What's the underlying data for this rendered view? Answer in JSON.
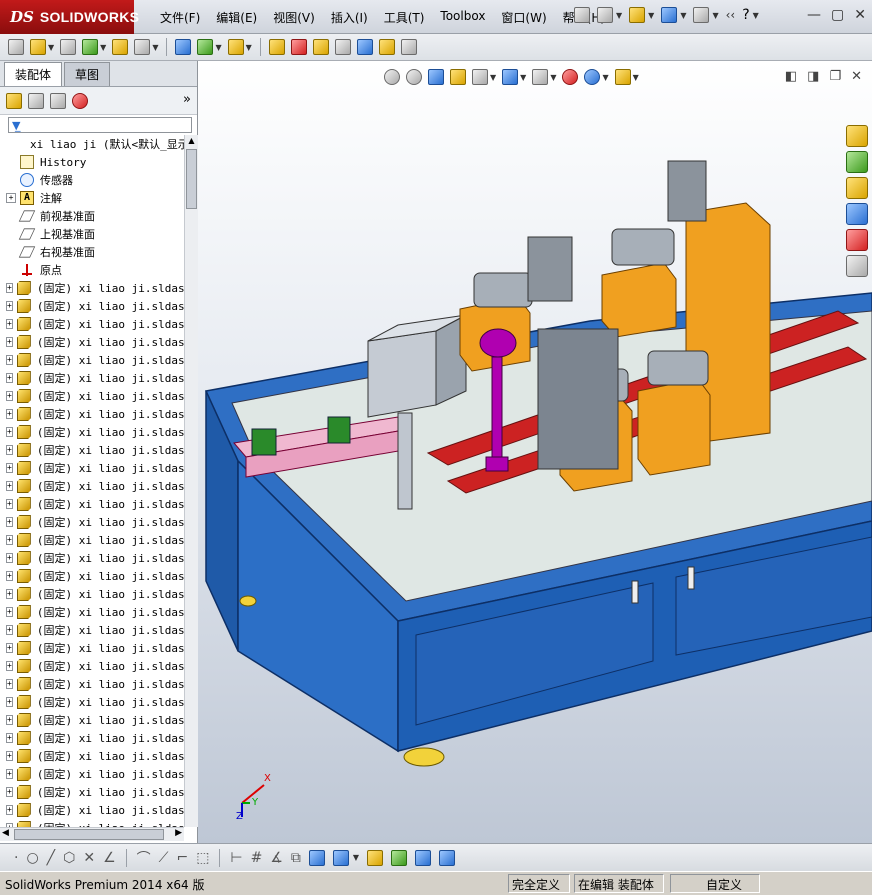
{
  "app": {
    "logo_ds": "DS",
    "logo_text": "SOLIDWORKS"
  },
  "menu": {
    "items": [
      "文件(F)",
      "编辑(E)",
      "视图(V)",
      "插入(I)",
      "工具(T)",
      "Toolbox",
      "窗口(W)",
      "帮助(H)"
    ]
  },
  "feature_manager": {
    "tabs": [
      "装配体",
      "草图"
    ],
    "chevron": "»",
    "filter_icon": "funnel-icon",
    "tree": [
      {
        "label": "xi liao ji  (默认<默认_显示",
        "icon": "assembly",
        "expand": "none"
      },
      {
        "label": "History",
        "icon": "hist",
        "expand": "none"
      },
      {
        "label": "传感器",
        "icon": "sensor",
        "expand": "none"
      },
      {
        "label": "注解",
        "icon": "annot",
        "expand": "plus"
      },
      {
        "label": "前视基准面",
        "icon": "plane",
        "expand": "none"
      },
      {
        "label": "上视基准面",
        "icon": "plane",
        "expand": "none"
      },
      {
        "label": "右视基准面",
        "icon": "plane",
        "expand": "none"
      },
      {
        "label": "原点",
        "icon": "origin",
        "expand": "none"
      },
      {
        "label": "(固定) xi liao ji.sldas",
        "icon": "part",
        "expand": "plus"
      },
      {
        "label": "(固定) xi liao ji.sldas",
        "icon": "part",
        "expand": "plus"
      },
      {
        "label": "(固定) xi liao ji.sldas",
        "icon": "part",
        "expand": "plus"
      },
      {
        "label": "(固定) xi liao ji.sldas",
        "icon": "part",
        "expand": "plus"
      },
      {
        "label": "(固定) xi liao ji.sldas",
        "icon": "part",
        "expand": "plus"
      },
      {
        "label": "(固定) xi liao ji.sldas",
        "icon": "part",
        "expand": "plus"
      },
      {
        "label": "(固定) xi liao ji.sldas",
        "icon": "part",
        "expand": "plus"
      },
      {
        "label": "(固定) xi liao ji.sldas",
        "icon": "part",
        "expand": "plus"
      },
      {
        "label": "(固定) xi liao ji.sldas",
        "icon": "part",
        "expand": "plus"
      },
      {
        "label": "(固定) xi liao ji.sldas",
        "icon": "part",
        "expand": "plus"
      },
      {
        "label": "(固定) xi liao ji.sldas",
        "icon": "part",
        "expand": "plus"
      },
      {
        "label": "(固定) xi liao ji.sldas",
        "icon": "part",
        "expand": "plus"
      },
      {
        "label": "(固定) xi liao ji.sldas",
        "icon": "part",
        "expand": "plus"
      },
      {
        "label": "(固定) xi liao ji.sldas",
        "icon": "part",
        "expand": "plus"
      },
      {
        "label": "(固定) xi liao ji.sldas",
        "icon": "part",
        "expand": "plus"
      },
      {
        "label": "(固定) xi liao ji.sldas",
        "icon": "part",
        "expand": "plus"
      },
      {
        "label": "(固定) xi liao ji.sldas",
        "icon": "part",
        "expand": "plus"
      },
      {
        "label": "(固定) xi liao ji.sldas",
        "icon": "part",
        "expand": "plus"
      },
      {
        "label": "(固定) xi liao ji.sldas",
        "icon": "part",
        "expand": "plus"
      },
      {
        "label": "(固定) xi liao ji.sldas",
        "icon": "part",
        "expand": "plus"
      },
      {
        "label": "(固定) xi liao ji.sldas",
        "icon": "part",
        "expand": "plus"
      },
      {
        "label": "(固定) xi liao ji.sldas",
        "icon": "part",
        "expand": "plus"
      },
      {
        "label": "(固定) xi liao ji.sldas",
        "icon": "part",
        "expand": "plus"
      },
      {
        "label": "(固定) xi liao ji.sldas",
        "icon": "part",
        "expand": "plus"
      },
      {
        "label": "(固定) xi liao ji.sldas",
        "icon": "part",
        "expand": "plus"
      },
      {
        "label": "(固定) xi liao ji.sldas",
        "icon": "part",
        "expand": "plus"
      },
      {
        "label": "(固定) xi liao ji.sldas",
        "icon": "part",
        "expand": "plus"
      },
      {
        "label": "(固定) xi liao ji.sldas",
        "icon": "part",
        "expand": "plus"
      },
      {
        "label": "(固定) xi liao ji.sldas",
        "icon": "part",
        "expand": "plus"
      },
      {
        "label": "(固定) xi liao ji.sldas",
        "icon": "part",
        "expand": "plus"
      },
      {
        "label": "(固定) xi liao ji.sldas",
        "icon": "part",
        "expand": "plus"
      },
      {
        "label": "(固定) xi liao ji.sldas",
        "icon": "part",
        "expand": "plus"
      }
    ]
  },
  "viewport": {
    "triad": {
      "x": "X",
      "y": "Y",
      "z": "Z"
    },
    "model_colors": {
      "frame": "#1e5fb4",
      "base": "#3a80d4",
      "orange": "#f0a020",
      "panel": "#b7bfc9",
      "green": "#2a8a2a",
      "magenta": "#b000b0"
    }
  },
  "status": {
    "product": "SolidWorks Premium 2014 x64 版",
    "defined": "完全定义",
    "editing": "在编辑 装配体",
    "custom": "自定义"
  }
}
